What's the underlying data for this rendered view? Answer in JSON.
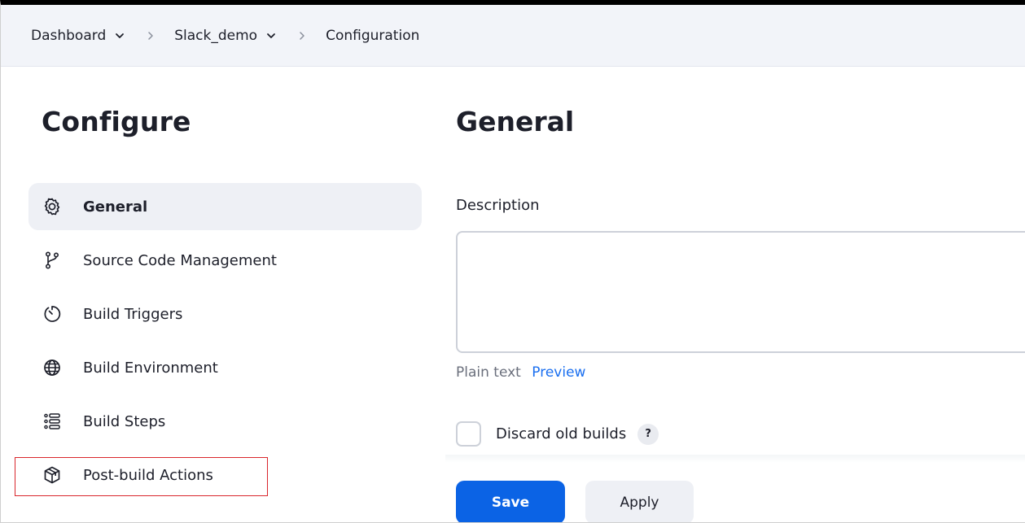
{
  "breadcrumb": {
    "items": [
      {
        "label": "Dashboard",
        "has_menu": true
      },
      {
        "label": "Slack_demo",
        "has_menu": true
      },
      {
        "label": "Configuration",
        "has_menu": false
      }
    ]
  },
  "sidebar": {
    "title": "Configure",
    "items": [
      {
        "label": "General",
        "icon": "gear-icon",
        "active": true
      },
      {
        "label": "Source Code Management",
        "icon": "branch-icon",
        "active": false
      },
      {
        "label": "Build Triggers",
        "icon": "timer-icon",
        "active": false
      },
      {
        "label": "Build Environment",
        "icon": "globe-icon",
        "active": false
      },
      {
        "label": "Build Steps",
        "icon": "list-icon",
        "active": false
      },
      {
        "label": "Post-build Actions",
        "icon": "package-icon",
        "active": false,
        "highlighted": true
      }
    ],
    "highlight_color": "#d9262c"
  },
  "main": {
    "title": "General",
    "description_label": "Description",
    "description_value": "",
    "format_label": "Plain text",
    "preview_label": "Preview",
    "discard_label": "Discard old builds",
    "discard_checked": false,
    "help_label": "?"
  },
  "actions": {
    "save_label": "Save",
    "apply_label": "Apply"
  },
  "colors": {
    "accent": "#0b63e5",
    "link": "#1a6ff0",
    "breadcrumb_bg": "#f2f4f9",
    "active_nav_bg": "#eef0f5"
  }
}
